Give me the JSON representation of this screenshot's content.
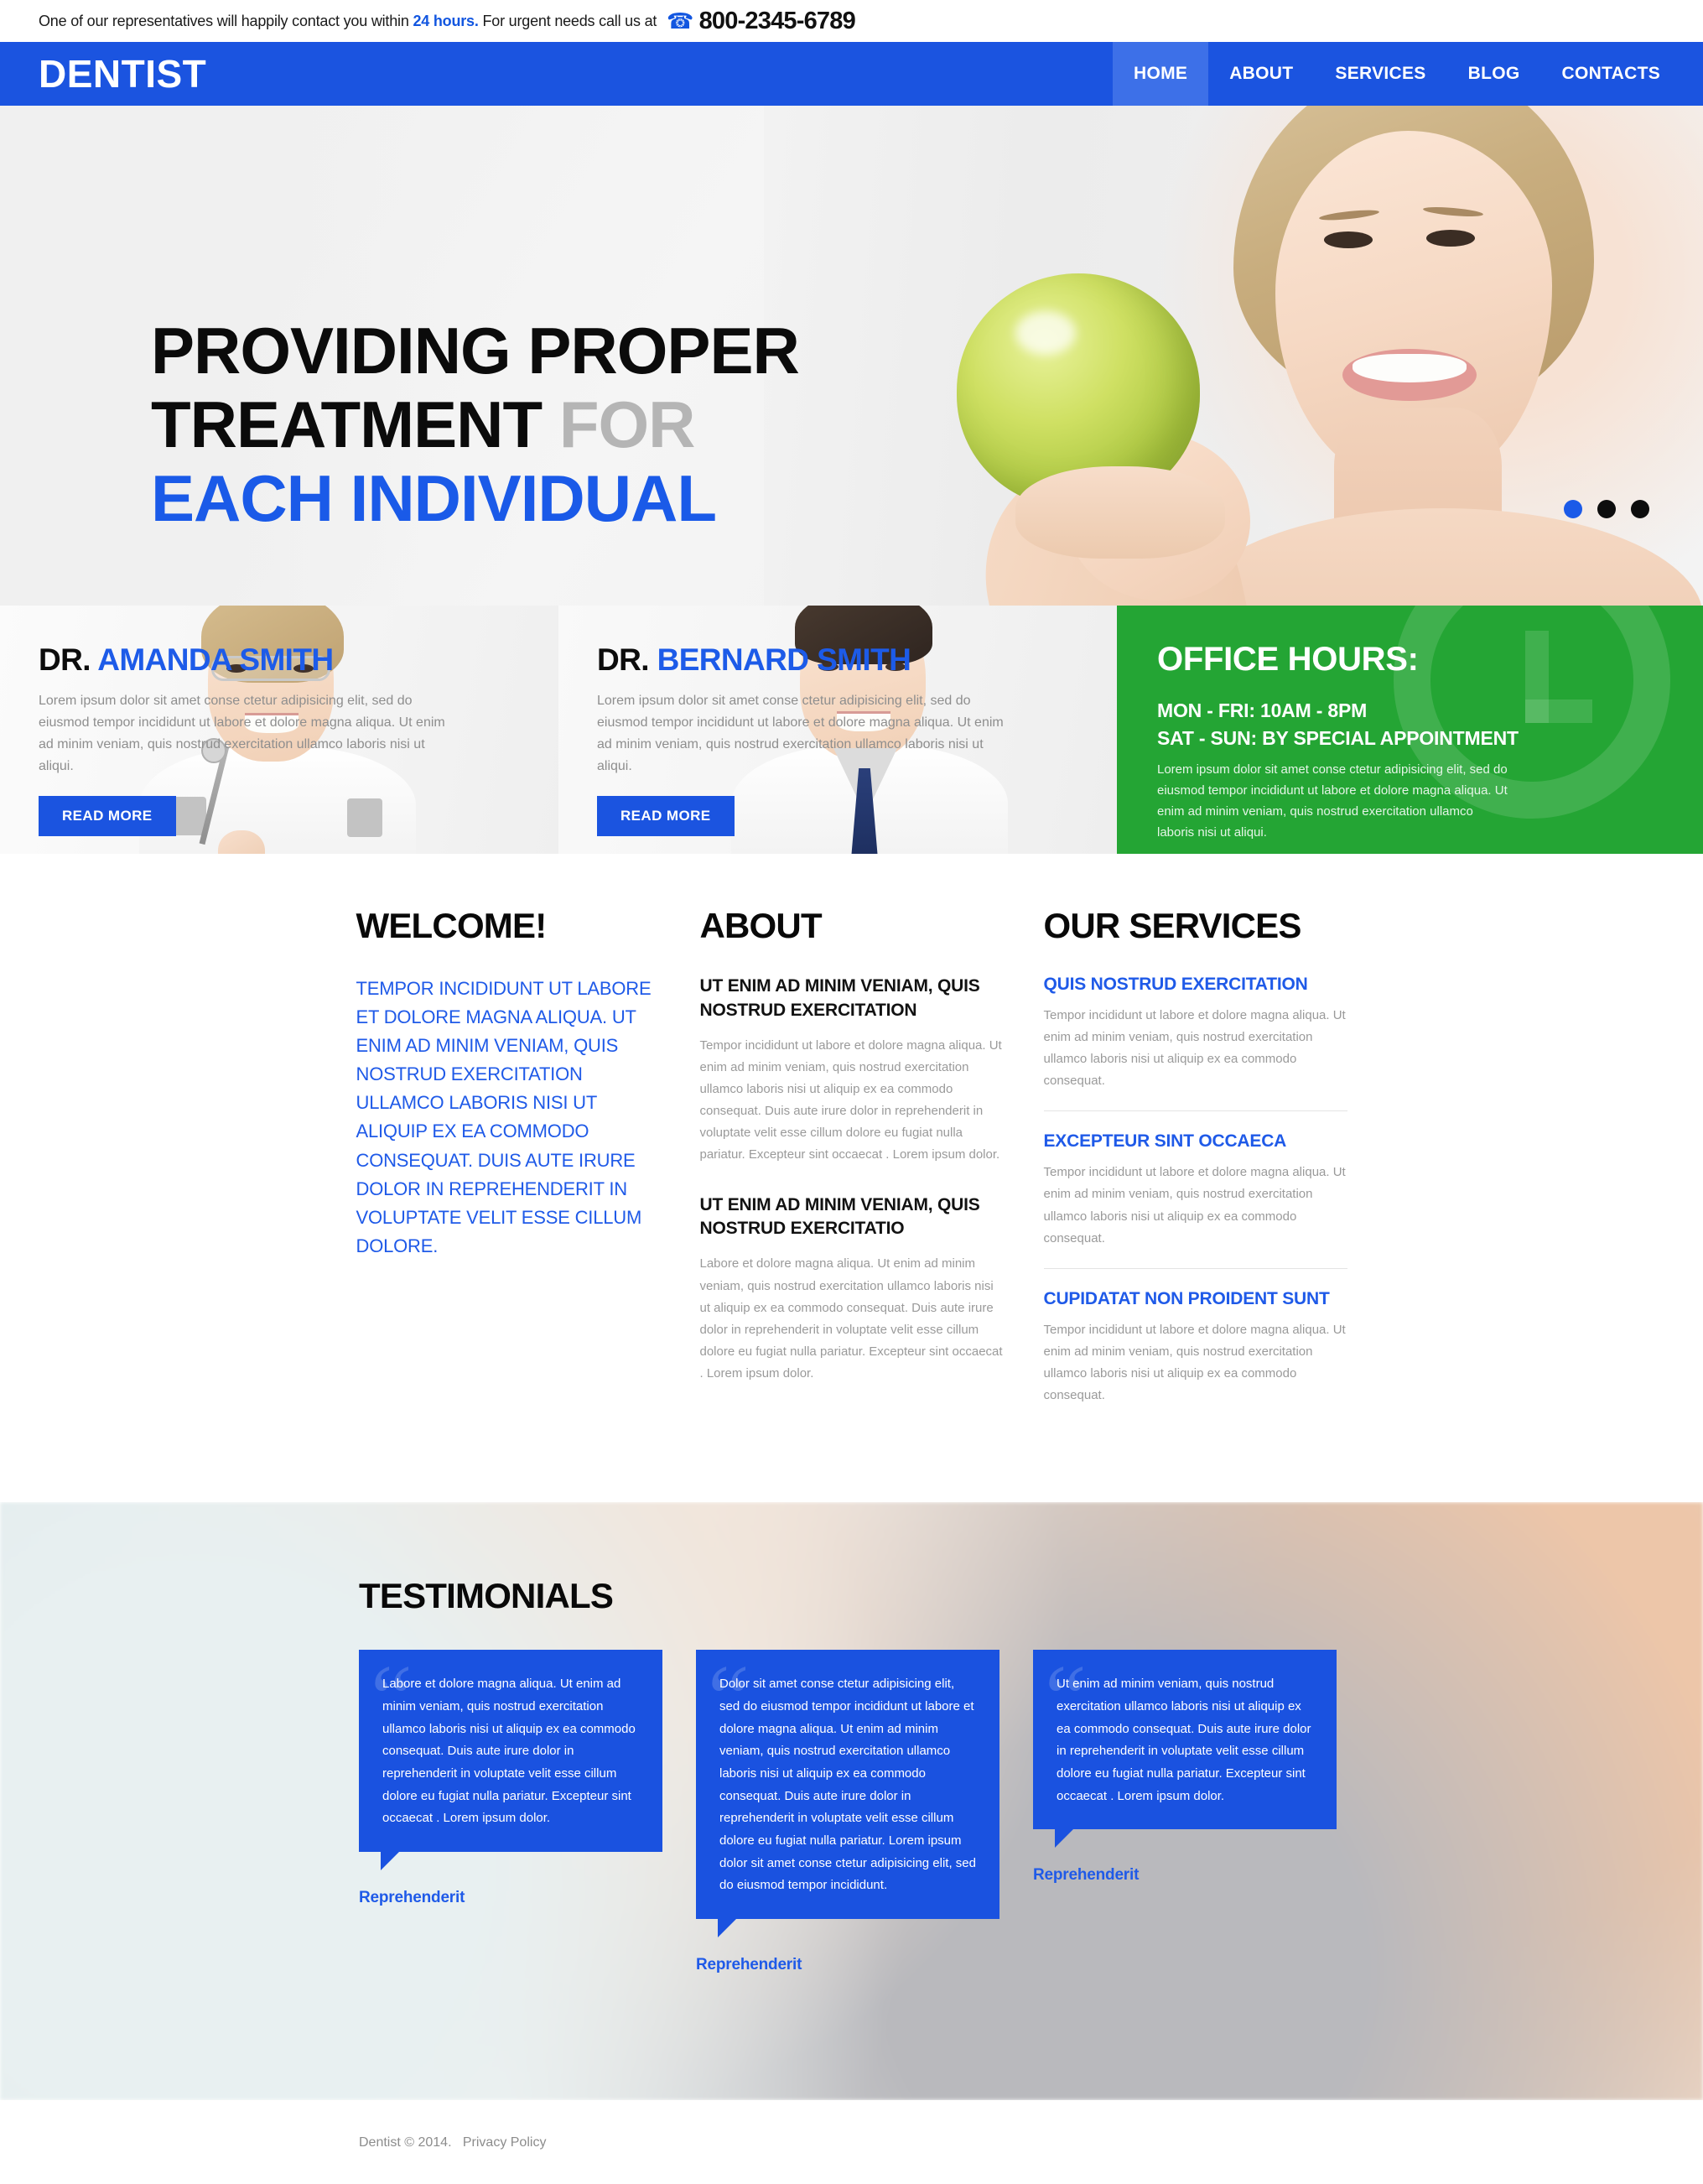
{
  "topbar": {
    "text_before": "One of our representatives will happily contact you within ",
    "highlight": "24 hours.",
    "text_after": " For urgent needs call us at",
    "phone_icon": "phone-icon",
    "phone": "800-2345-6789"
  },
  "header": {
    "logo": "DENTIST",
    "nav": [
      {
        "label": "HOME",
        "active": true
      },
      {
        "label": "ABOUT",
        "active": false
      },
      {
        "label": "SERVICES",
        "active": false
      },
      {
        "label": "BLOG",
        "active": false
      },
      {
        "label": "CONTACTS",
        "active": false
      }
    ]
  },
  "hero": {
    "line1": "PROVIDING PROPER",
    "line2_dark": "TREATMENT ",
    "line2_muted": "FOR",
    "line3": "EACH INDIVIDUAL",
    "slides": [
      {
        "active": true
      },
      {
        "active": false
      },
      {
        "active": false
      }
    ]
  },
  "doctors": [
    {
      "prefix": "DR. ",
      "name": "AMANDA SMITH",
      "desc": "Lorem ipsum dolor sit amet conse ctetur adipisicing elit, sed do eiusmod tempor incididunt ut labore et dolore magna aliqua. Ut enim ad minim veniam, quis nostrud exercitation ullamco laboris nisi ut aliqui.",
      "button": "READ MORE"
    },
    {
      "prefix": "DR. ",
      "name": "BERNARD SMITH",
      "desc": "Lorem ipsum dolor sit amet conse ctetur adipisicing elit, sed do eiusmod tempor incididunt ut labore et dolore magna aliqua. Ut enim ad minim veniam, quis nostrud exercitation ullamco laboris nisi ut aliqui.",
      "button": "READ MORE"
    }
  ],
  "office_hours": {
    "title": "OFFICE HOURS:",
    "line1": "MON - FRI: 10AM - 8PM",
    "line2": "SAT - SUN: BY SPECIAL APPOINTMENT",
    "desc": "Lorem ipsum dolor sit amet conse ctetur adipisicing elit, sed do eiusmod tempor incididunt ut labore et dolore magna aliqua. Ut enim ad minim veniam, quis nostrud exercitation ullamco laboris nisi ut aliqui.",
    "bg_color": "#24a534",
    "watermark_icon": "clock-icon"
  },
  "welcome": {
    "title": "WELCOME!",
    "lead": "TEMPOR INCIDIDUNT UT LABORE ET DOLORE MAGNA ALIQUA. UT ENIM AD MINIM VENIAM, QUIS NOSTRUD EXERCITATION ULLAMCO LABORIS NISI UT ALIQUIP EX EA COMMODO CONSEQUAT. DUIS AUTE IRURE DOLOR IN REPREHENDERIT IN VOLUPTATE VELIT ESSE CILLUM DOLORE."
  },
  "about": {
    "title": "ABOUT",
    "blocks": [
      {
        "heading": "UT ENIM AD MINIM VENIAM, QUIS NOSTRUD EXERCITATION",
        "text": "Tempor incididunt ut labore et dolore magna aliqua. Ut enim ad minim veniam, quis nostrud exercitation ullamco laboris nisi ut aliquip ex ea commodo consequat. Duis aute irure dolor in reprehenderit in voluptate velit esse cillum dolore eu fugiat nulla pariatur. Excepteur sint occaecat . Lorem ipsum dolor."
      },
      {
        "heading": "UT ENIM AD MINIM VENIAM, QUIS NOSTRUD EXERCITATIO",
        "text": "Labore et dolore magna aliqua. Ut enim ad minim veniam, quis nostrud exercitation ullamco laboris nisi ut aliquip ex ea commodo consequat. Duis aute irure dolor in reprehenderit in voluptate velit esse cillum dolore eu fugiat nulla pariatur. Excepteur sint occaecat . Lorem ipsum dolor."
      }
    ]
  },
  "services": {
    "title": "OUR SERVICES",
    "items": [
      {
        "heading": "QUIS NOSTRUD EXERCITATION",
        "text": "Tempor incididunt ut labore et dolore magna aliqua. Ut enim ad minim veniam, quis nostrud exercitation ullamco laboris nisi ut aliquip ex ea commodo consequat."
      },
      {
        "heading": "EXCEPTEUR SINT OCCAECA",
        "text": "Tempor incididunt ut labore et dolore magna aliqua. Ut enim ad minim veniam, quis nostrud exercitation ullamco laboris nisi ut aliquip ex ea commodo consequat."
      },
      {
        "heading": "CUPIDATAT NON PROIDENT SUNT",
        "text": "Tempor incididunt ut labore et dolore magna aliqua. Ut enim ad minim veniam, quis nostrud exercitation ullamco laboris nisi ut aliquip ex ea commodo consequat."
      }
    ]
  },
  "testimonials": {
    "title": "TESTIMONIALS",
    "quote_glyph": "“",
    "items": [
      {
        "text": "Labore et dolore magna aliqua. Ut enim ad minim veniam, quis nostrud exercitation ullamco laboris nisi ut aliquip ex ea commodo consequat. Duis aute irure dolor in reprehenderit in voluptate velit esse cillum dolore eu fugiat nulla pariatur. Excepteur sint occaecat . Lorem ipsum dolor.",
        "author": "Reprehenderit"
      },
      {
        "text": "Dolor sit amet conse ctetur adipisicing elit, sed do eiusmod tempor incididunt ut labore et dolore magna aliqua. Ut enim ad minim veniam, quis nostrud exercitation ullamco laboris nisi ut aliquip ex ea commodo consequat. Duis aute irure dolor in reprehenderit in voluptate velit esse cillum dolore eu fugiat nulla pariatur. Lorem ipsum dolor sit amet conse ctetur adipisicing elit, sed do eiusmod tempor incididunt.",
        "author": "Reprehenderit"
      },
      {
        "text": "Ut enim ad minim veniam, quis nostrud exercitation ullamco laboris nisi ut aliquip ex ea commodo consequat. Duis aute irure dolor in reprehenderit in voluptate velit esse cillum dolore eu fugiat nulla pariatur. Excepteur sint occaecat . Lorem ipsum dolor.",
        "author": "Reprehenderit"
      }
    ]
  },
  "footer": {
    "copyright": "Dentist © 2014.",
    "privacy": "Privacy Policy"
  },
  "colors": {
    "brand_blue": "#1b54e0",
    "nav_active": "#3d70e8",
    "accent_green": "#24a534",
    "link_blue": "#1f5ae8",
    "muted_gray": "#9a9a9a"
  }
}
